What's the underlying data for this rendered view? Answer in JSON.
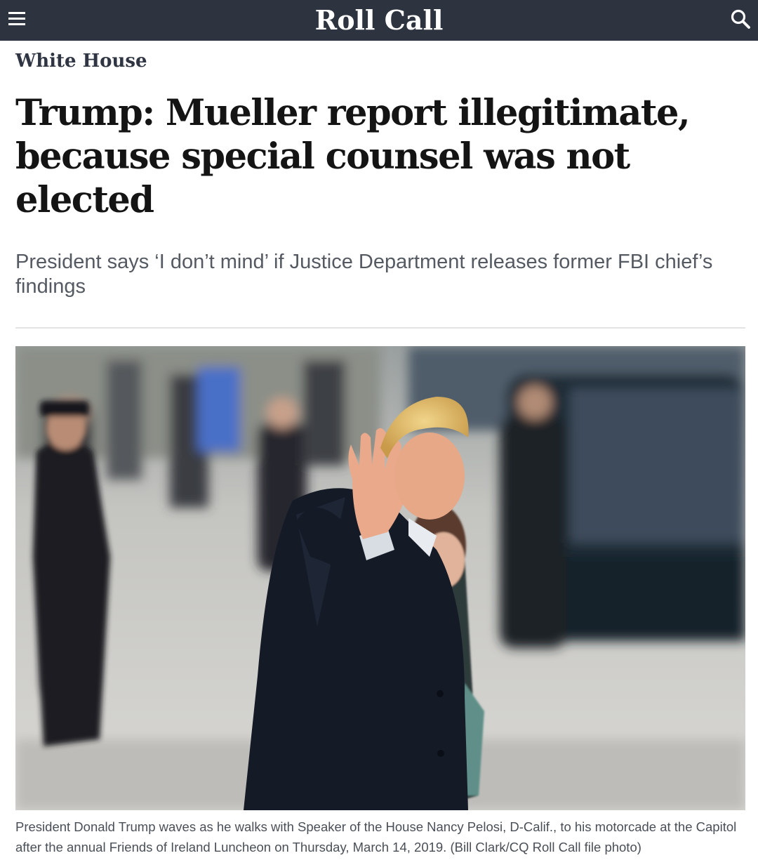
{
  "header": {
    "brand": "Roll Call",
    "menu_icon": "hamburger-menu-icon",
    "search_icon": "search-icon",
    "background_color": "#2d3440"
  },
  "article": {
    "section": "White House",
    "headline": "Trump: Mueller report illegitimate, because special counsel was not elected",
    "dek": "President says ‘I don’t mind’ if Justice Department releases former FBI chief’s findings",
    "photo_caption": "President Donald Trump waves as he walks with Speaker of the House Nancy Pelosi, D-Calif., to his motorcade at the Capitol after the annual Friends of Ireland Luncheon on Thursday, March 14, 2019. (Bill Clark/CQ Roll Call file photo)"
  }
}
